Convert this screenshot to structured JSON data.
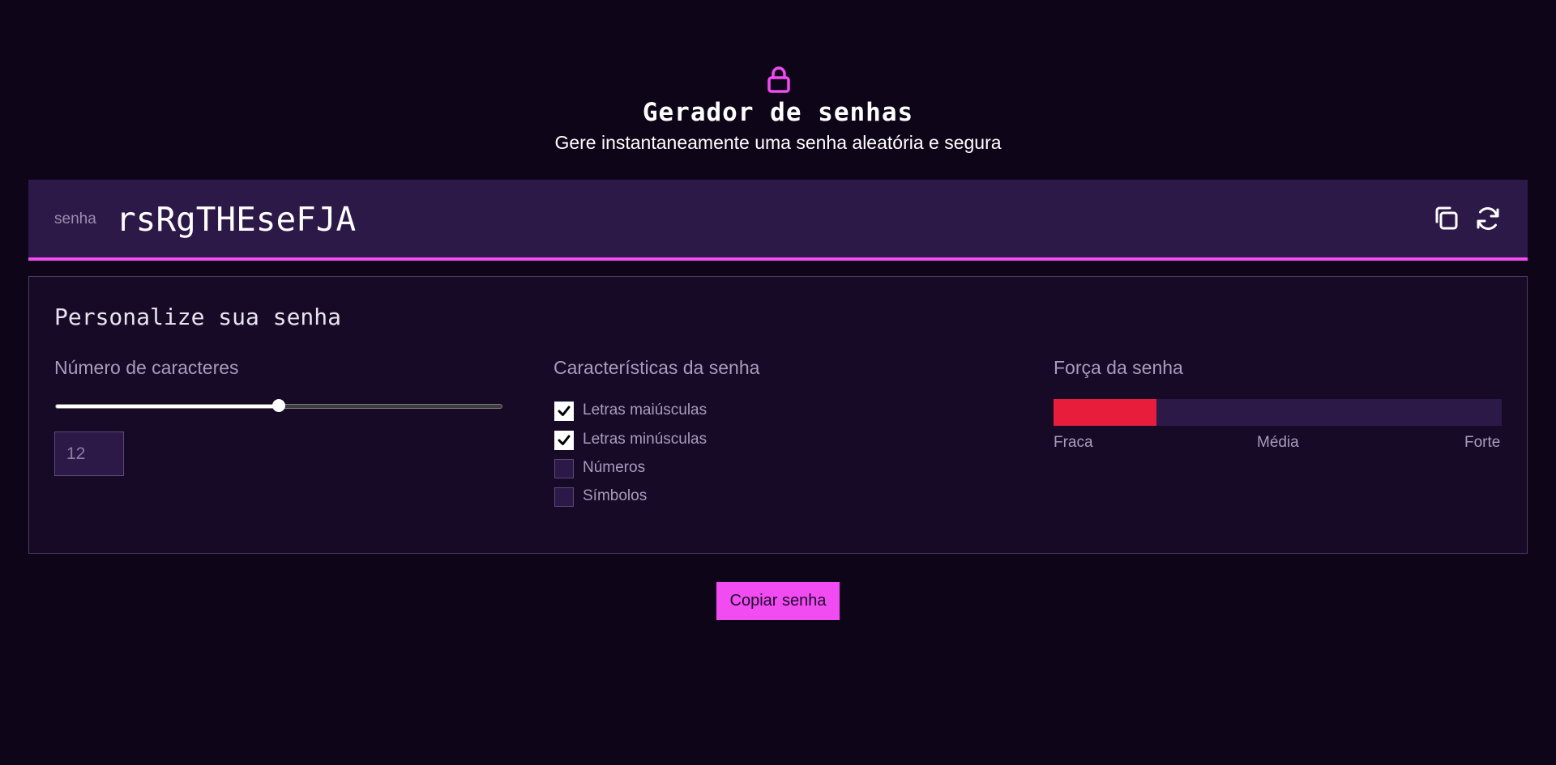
{
  "colors": {
    "accent": "#f14bf2",
    "background": "#0f0518",
    "panel": "#170a26",
    "field": "#2d1947",
    "strength_weak": "#e81d3b"
  },
  "header": {
    "icon": "lock-icon",
    "title": "Gerador de senhas",
    "subtitle": "Gere instantaneamente uma senha aleatória e segura"
  },
  "password": {
    "label": "senha",
    "value": "rsRgTHEseFJA",
    "copy_icon": "copy-icon",
    "refresh_icon": "refresh-icon"
  },
  "customize": {
    "title": "Personalize sua senha",
    "length": {
      "heading": "Número de caracteres",
      "value": "12",
      "slider_fraction": 0.5
    },
    "characteristics": {
      "heading": "Características da senha",
      "options": [
        {
          "label": "Letras maiúsculas",
          "checked": true
        },
        {
          "label": "Letras minúsculas",
          "checked": true
        },
        {
          "label": "Números",
          "checked": false
        },
        {
          "label": "Símbolos",
          "checked": false
        }
      ]
    },
    "strength": {
      "heading": "Força da senha",
      "level_fraction": 0.23,
      "labels": [
        "Fraca",
        "Média",
        "Forte"
      ]
    }
  },
  "copy_button": {
    "label": "Copiar senha"
  }
}
